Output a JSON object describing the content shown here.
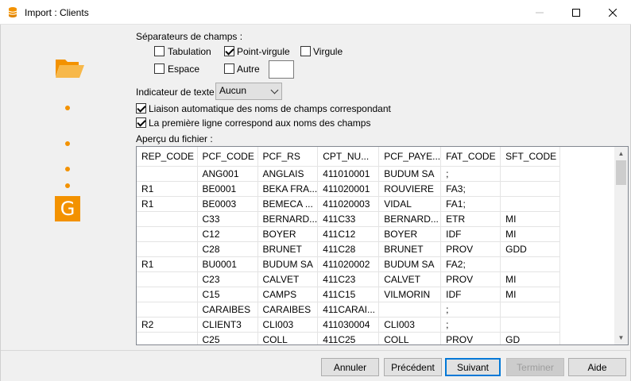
{
  "window": {
    "title": "Import : Clients"
  },
  "separators": {
    "label": "Séparateurs de champs :",
    "tabulation": {
      "label": "Tabulation",
      "checked": false
    },
    "point_virgule": {
      "label": "Point-virgule",
      "checked": true
    },
    "virgule": {
      "label": "Virgule",
      "checked": false
    },
    "espace": {
      "label": "Espace",
      "checked": false
    },
    "autre": {
      "label": "Autre",
      "checked": false,
      "value": ""
    }
  },
  "text_indicator": {
    "label": "Indicateur de texte",
    "value": "Aucun"
  },
  "options": {
    "auto_link": {
      "label": "Liaison automatique des noms de champs correspondant",
      "checked": true
    },
    "first_line": {
      "label": "La première ligne correspond aux noms des champs",
      "checked": true
    }
  },
  "preview": {
    "label": "Aperçu du fichier :",
    "columns": [
      "REP_CODE",
      "PCF_CODE",
      "PCF_RS",
      "CPT_NU...",
      "PCF_PAYE...",
      "FAT_CODE",
      "SFT_CODE"
    ],
    "rows": [
      [
        "",
        "ANG001",
        "ANGLAIS",
        "411010001",
        "BUDUM SA",
        ";",
        ""
      ],
      [
        "R1",
        "BE0001",
        "BEKA FRA...",
        "411020001",
        "ROUVIERE",
        "FA3;",
        ""
      ],
      [
        "R1",
        "BE0003",
        "BEMECA ...",
        "411020003",
        "VIDAL",
        "FA1;",
        ""
      ],
      [
        "",
        "C33",
        "BERNARD...",
        "411C33",
        "BERNARD...",
        "ETR",
        "MI"
      ],
      [
        "",
        "C12",
        "BOYER",
        "411C12",
        "BOYER",
        "IDF",
        "MI"
      ],
      [
        "",
        "C28",
        "BRUNET",
        "411C28",
        "BRUNET",
        "PROV",
        "GDD"
      ],
      [
        "R1",
        "BU0001",
        "BUDUM SA",
        "411020002",
        "BUDUM SA",
        "FA2;",
        ""
      ],
      [
        "",
        "C23",
        "CALVET",
        "411C23",
        "CALVET",
        "PROV",
        "MI"
      ],
      [
        "",
        "C15",
        "CAMPS",
        "411C15",
        "VILMORIN",
        "IDF",
        "MI"
      ],
      [
        "",
        "CARAIBES",
        "CARAIBES",
        "411CARAI...",
        "",
        ";",
        ""
      ],
      [
        "R2",
        "CLIENT3",
        "CLI003",
        "411030004",
        "CLI003",
        ";",
        ""
      ],
      [
        "",
        "C25",
        "COLL",
        "411C25",
        "COLL",
        "PROV",
        "GD"
      ]
    ]
  },
  "steps": {
    "current": "G"
  },
  "buttons": {
    "annuler": "Annuler",
    "precedent": "Précédent",
    "suivant": "Suivant",
    "terminer": "Terminer",
    "aide": "Aide"
  },
  "colors": {
    "accent": "#f39200",
    "focus": "#0078d7"
  }
}
